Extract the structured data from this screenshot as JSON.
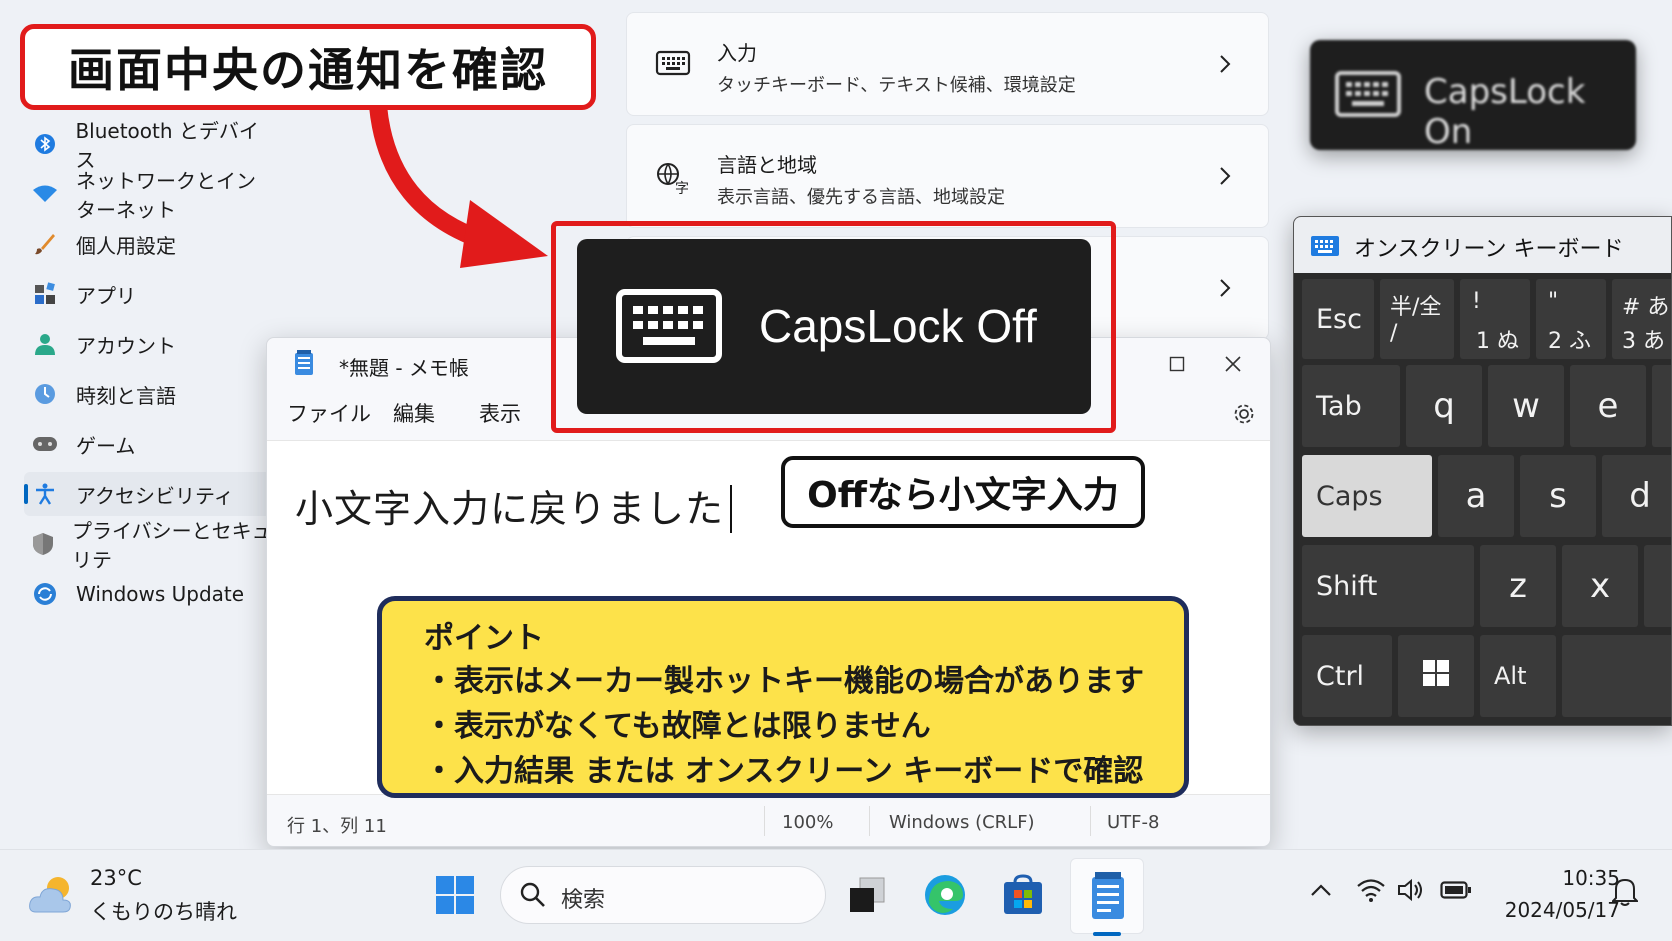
{
  "settings_nav": [
    {
      "label": "Bluetooth とデバイス",
      "icon": "bluetooth-icon"
    },
    {
      "label": "ネットワークとインターネット",
      "icon": "wifi-icon"
    },
    {
      "label": "個人用設定",
      "icon": "brush-icon"
    },
    {
      "label": "アプリ",
      "icon": "apps-icon"
    },
    {
      "label": "アカウント",
      "icon": "person-icon"
    },
    {
      "label": "時刻と言語",
      "icon": "clock-globe-icon"
    },
    {
      "label": "ゲーム",
      "icon": "gamepad-icon"
    },
    {
      "label": "アクセシビリティ",
      "icon": "accessibility-icon",
      "selected": true
    },
    {
      "label": "プライバシーとセキュリテ",
      "icon": "shield-icon"
    },
    {
      "label": "Windows Update",
      "icon": "update-icon"
    }
  ],
  "settings_cards": [
    {
      "title": "入力",
      "subtitle": "タッチキーボード、テキスト候補、環境設定",
      "icon": "keyboard-icon"
    },
    {
      "title": "言語と地域",
      "subtitle": "表示言語、優先する言語、地域設定",
      "icon": "language-icon"
    }
  ],
  "callouts": {
    "top": "画面中央の通知を確認",
    "off_hint": "Offなら小文字入力"
  },
  "toasts": {
    "caps_off": "CapsLock Off",
    "caps_on": "CapsLock On"
  },
  "notepad": {
    "title": "*無題 - メモ帳",
    "menu": [
      "ファイル",
      "編集",
      "表示"
    ],
    "text": "小文字入力に戻りました",
    "status": {
      "position": "行 1、列 11",
      "zoom": "100%",
      "line_ending": "Windows (CRLF)",
      "encoding": "UTF-8"
    }
  },
  "osk": {
    "title": "オンスクリーン キーボード",
    "keys": {
      "esc": "Esc",
      "hankaku_top": "半/全",
      "hankaku_bottom": "/",
      "k1_top": "!",
      "k1_bottom": "1 ぬ",
      "k2_top": "\"",
      "k2_bottom": "2 ふ",
      "k3_top": "# あ",
      "k3_bottom": "3 あ",
      "tab": "Tab",
      "q": "q",
      "w": "w",
      "e": "e",
      "caps": "Caps",
      "a": "a",
      "s": "s",
      "d": "d",
      "shift": "Shift",
      "z": "z",
      "x": "x",
      "ctrl": "Ctrl",
      "alt": "Alt"
    }
  },
  "point": {
    "title": "ポイント",
    "lines": [
      "・表示はメーカー製ホットキー機能の場合があります",
      "・表示がなくても故障とは限りません",
      "・入力結果 または オンスクリーン キーボードで確認"
    ]
  },
  "taskbar": {
    "temperature": "23°C",
    "weather": "くもりのち晴れ",
    "search_placeholder": "検索",
    "time": "10:35",
    "date": "2024/05/17"
  },
  "colors": {
    "accent": "#0067c0",
    "highlight_red": "#e11b1b",
    "point_yellow": "#fde24a",
    "point_border": "#1f2d5c",
    "toast_bg": "#1e1e1e"
  }
}
